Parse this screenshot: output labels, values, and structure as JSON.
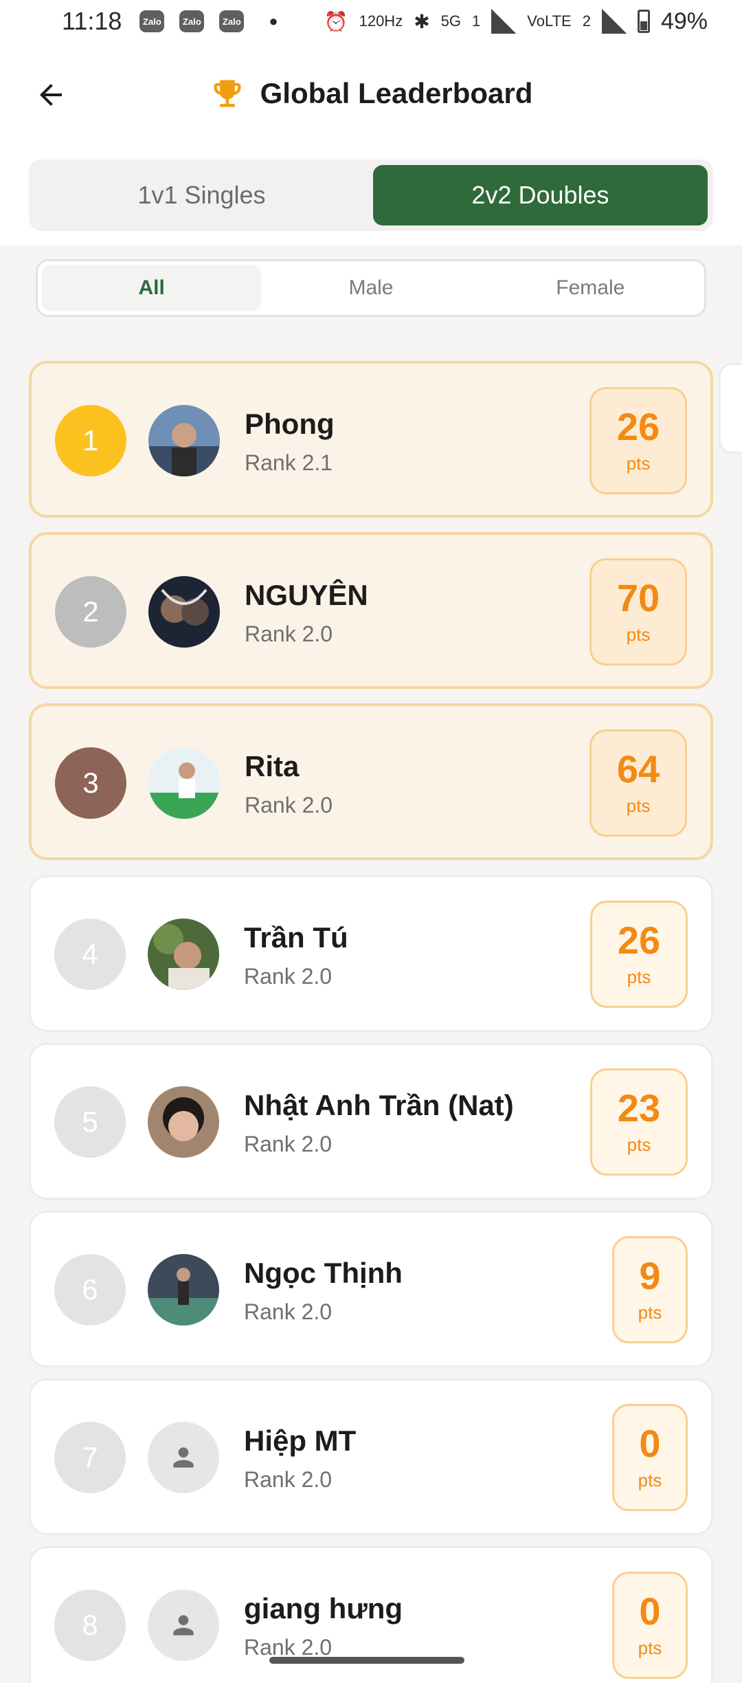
{
  "status_bar": {
    "time": "11:18",
    "notif_apps": [
      "Zalo",
      "Zalo",
      "Zalo"
    ],
    "network": "5G",
    "sim_badge": "1",
    "volte": "VoLTE",
    "sim2_badge": "2",
    "refresh_rate": "120Hz",
    "battery": "49%"
  },
  "header": {
    "title": "Global Leaderboard",
    "back_icon": "arrow-left-icon",
    "title_icon": "trophy-icon",
    "accent_color": "#f39c12"
  },
  "mode_tabs": [
    {
      "label": "1v1 Singles",
      "active": false
    },
    {
      "label": "2v2 Doubles",
      "active": true
    }
  ],
  "gender_tabs": [
    {
      "label": "All",
      "active": true
    },
    {
      "label": "Male",
      "active": false
    },
    {
      "label": "Female",
      "active": false
    }
  ],
  "colors": {
    "primary_green": "#2f6a3a",
    "points_orange": "#f28a14",
    "gold": "#fbc21f",
    "silver": "#bdbdbd",
    "bronze": "#8d6457"
  },
  "players": [
    {
      "rank": "1",
      "name": "Phong",
      "level": "Rank 2.1",
      "points": "26",
      "unit": "pts",
      "avatar": "photo"
    },
    {
      "rank": "2",
      "name": "NGUYÊN",
      "level": "Rank 2.0",
      "points": "70",
      "unit": "pts",
      "avatar": "photo"
    },
    {
      "rank": "3",
      "name": "Rita",
      "level": "Rank 2.0",
      "points": "64",
      "unit": "pts",
      "avatar": "photo"
    },
    {
      "rank": "4",
      "name": "Trần Tú",
      "level": "Rank 2.0",
      "points": "26",
      "unit": "pts",
      "avatar": "photo"
    },
    {
      "rank": "5",
      "name": "Nhật Anh Trần (Nat)",
      "level": "Rank 2.0",
      "points": "23",
      "unit": "pts",
      "avatar": "photo"
    },
    {
      "rank": "6",
      "name": "Ngọc Thịnh",
      "level": "Rank 2.0",
      "points": "9",
      "unit": "pts",
      "avatar": "photo"
    },
    {
      "rank": "7",
      "name": "Hiệp MT",
      "level": "Rank 2.0",
      "points": "0",
      "unit": "pts",
      "avatar": "person-placeholder-icon"
    },
    {
      "rank": "8",
      "name": "giang hưng",
      "level": "Rank 2.0",
      "points": "0",
      "unit": "pts",
      "avatar": "person-placeholder-icon"
    }
  ]
}
